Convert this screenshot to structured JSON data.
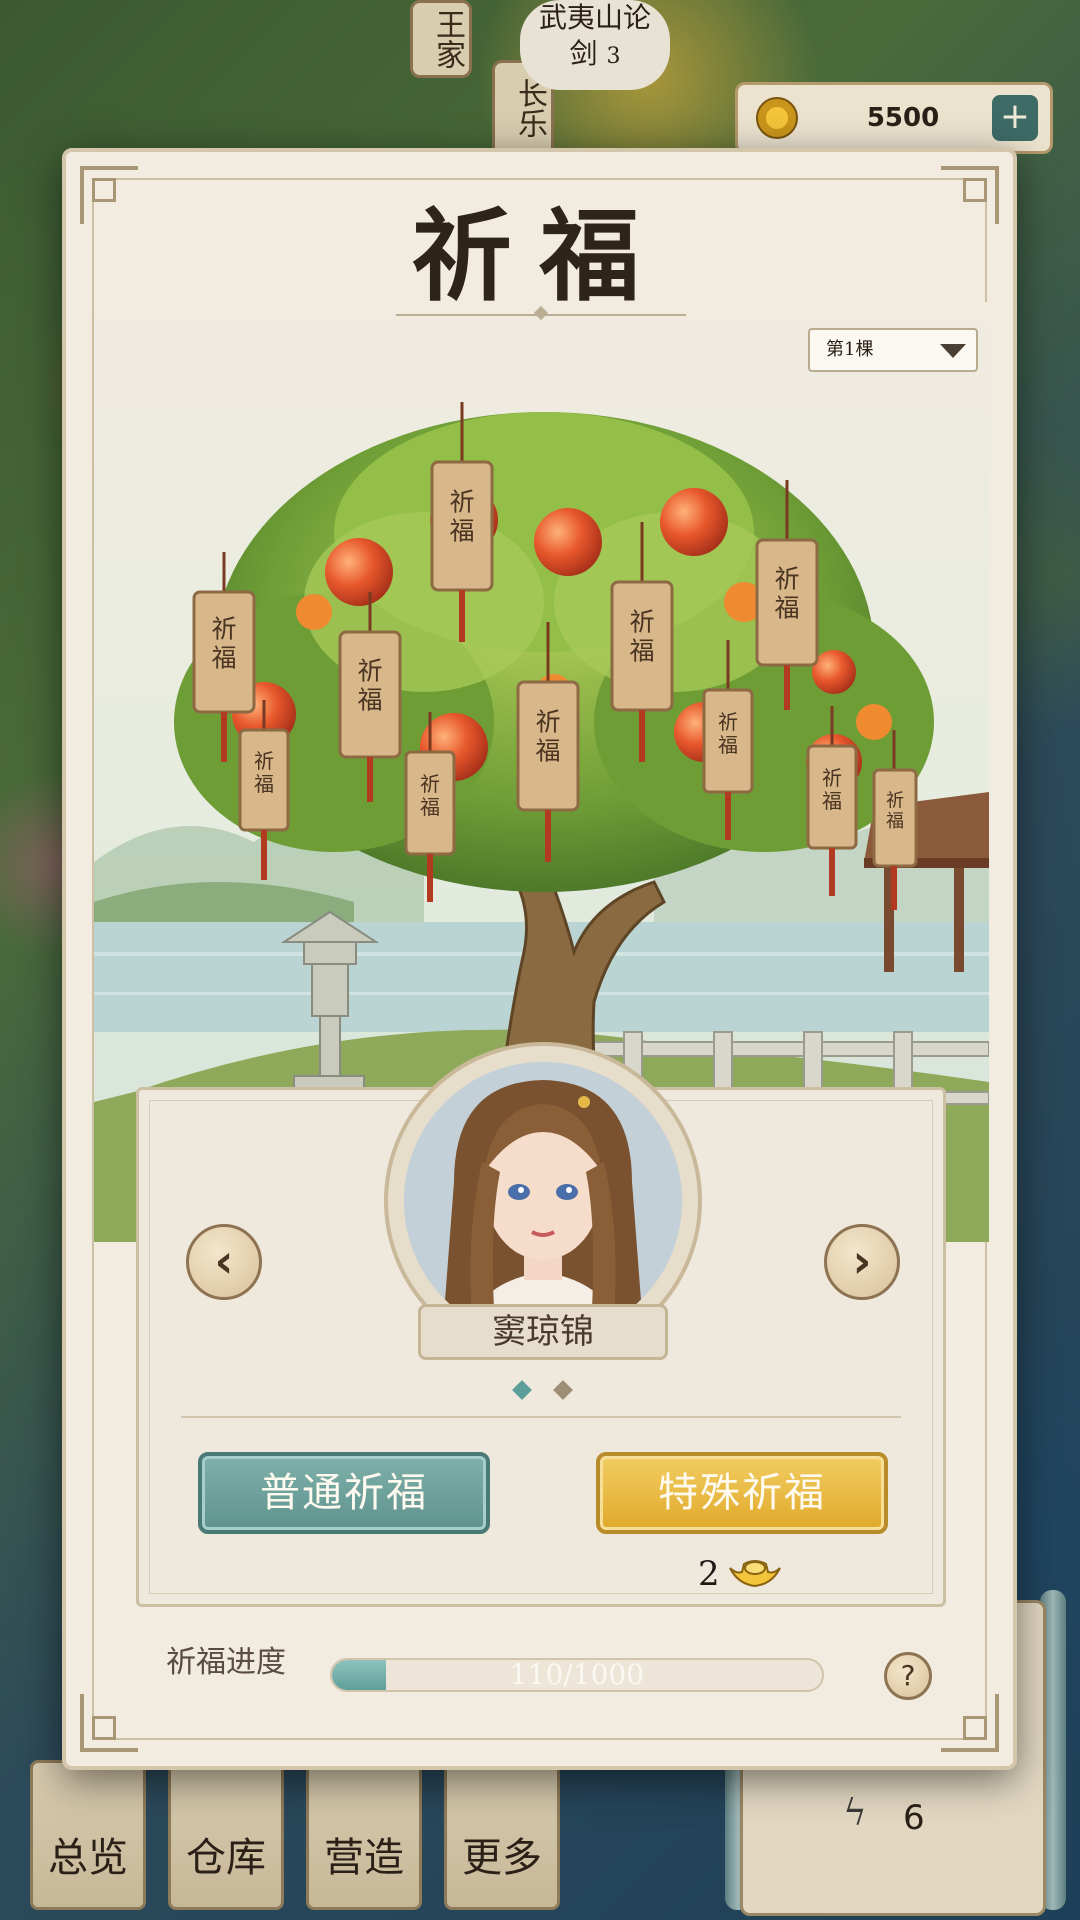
{
  "background": {
    "coin_amount": "5500",
    "coin_plus": "+",
    "plate_left": "王家",
    "plate_center": "长乐",
    "cloud_label_line1": "武夷山论",
    "cloud_label_line2": "剑",
    "cloud_label_count": "3",
    "bottom_tabs": [
      "总览",
      "仓库",
      "营造",
      "更多"
    ],
    "side_stat_value": "6"
  },
  "modal": {
    "title": "祈福",
    "tree_select": {
      "selected": "第1棵"
    },
    "tag_text": "祈福",
    "character": {
      "name": "窦琼锦",
      "prev_glyph": "‹",
      "next_glyph": "›",
      "page_count": 2,
      "active_page": 1
    },
    "buttons": {
      "normal_label": "普通祈福",
      "special_label": "特殊祈福",
      "special_cost": "2"
    },
    "progress": {
      "label": "祈福进度",
      "text": "110/1000",
      "fraction": 0.11
    },
    "help_glyph": "?"
  },
  "colors": {
    "teal_accent": "#5f938e",
    "gold_accent": "#e0a92a",
    "panel_bg": "#f1ebe0"
  },
  "icons": [
    "coin-icon",
    "plus-icon",
    "chevron-left-icon",
    "chevron-right-icon",
    "gold-ingot-icon",
    "help-icon",
    "dropdown-caret-icon",
    "lightning-icon"
  ]
}
